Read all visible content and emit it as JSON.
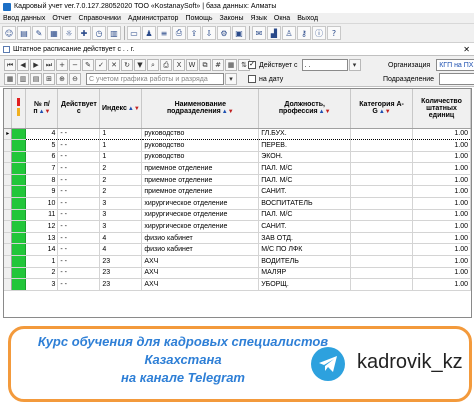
{
  "window": {
    "title": "Кадровый учет ver.7.0.127.28052020 ТОО «KostanaySoft» | база данных: Алматы"
  },
  "menu": [
    "Ввод данных",
    "Отчет",
    "Справочники",
    "Администратор",
    "Помощь",
    "Законы",
    "Язык",
    "Окна",
    "Выход"
  ],
  "document": {
    "title": "Штатное расписание действует с  .  .  г."
  },
  "filters": {
    "search_placeholder": "С учетом графика работы и разряда",
    "effective_label": "Действует с",
    "effective_value": ".  .",
    "on_date_label": "на дату",
    "organization_label": "Организация",
    "organization_value": "КГП на ПХВ",
    "department_label": "Подразделение",
    "effective_checked": "✓"
  },
  "table": {
    "columns": [
      "№ п/п",
      "Действует с",
      "Индекс",
      "Наименование подразделения",
      "Должность, профессия",
      "Категория А-G",
      "Количество штатных единиц"
    ],
    "rows": [
      {
        "n": "4",
        "from": "-  -",
        "idx": "1",
        "dept": "руководство",
        "pos": "ГЛ.БУХ.",
        "cat": "",
        "qty": "1.00"
      },
      {
        "n": "5",
        "from": "-  -",
        "idx": "1",
        "dept": "руководство",
        "pos": "ПЕРЕВ.",
        "cat": "",
        "qty": "1.00"
      },
      {
        "n": "6",
        "from": "-  -",
        "idx": "1",
        "dept": "руководство",
        "pos": "ЭКОН.",
        "cat": "",
        "qty": "1.00"
      },
      {
        "n": "7",
        "from": "-  -",
        "idx": "2",
        "dept": "приемное отделение",
        "pos": "ПАЛ. М/С",
        "cat": "",
        "qty": "1.00"
      },
      {
        "n": "8",
        "from": "-  -",
        "idx": "2",
        "dept": "приемное отделение",
        "pos": "ПАЛ. М/С",
        "cat": "",
        "qty": "1.00"
      },
      {
        "n": "9",
        "from": "-  -",
        "idx": "2",
        "dept": "приемное отделение",
        "pos": "САНИТ.",
        "cat": "",
        "qty": "1.00"
      },
      {
        "n": "10",
        "from": "-  -",
        "idx": "3",
        "dept": "хирургическое отделение",
        "pos": "ВОСПИТАТЕЛЬ",
        "cat": "",
        "qty": "1.00"
      },
      {
        "n": "11",
        "from": "-  -",
        "idx": "3",
        "dept": "хирургическое отделение",
        "pos": "ПАЛ. М/С",
        "cat": "",
        "qty": "1.00"
      },
      {
        "n": "12",
        "from": "-  -",
        "idx": "3",
        "dept": "хирургическое отделение",
        "pos": "САНИТ.",
        "cat": "",
        "qty": "1.00"
      },
      {
        "n": "13",
        "from": "-  -",
        "idx": "4",
        "dept": "физио кабинет",
        "pos": "ЗАВ ОТД.",
        "cat": "",
        "qty": "1.00"
      },
      {
        "n": "14",
        "from": "-  -",
        "idx": "4",
        "dept": "физио кабинет",
        "pos": "М/С ПО ЛФК",
        "cat": "",
        "qty": "1.00"
      },
      {
        "n": "1",
        "from": "-  -",
        "idx": "23",
        "dept": "АХЧ",
        "pos": "ВОДИТЕЛЬ",
        "cat": "",
        "qty": "1.00"
      },
      {
        "n": "2",
        "from": "-  -",
        "idx": "23",
        "dept": "АХЧ",
        "pos": "МАЛЯР",
        "cat": "",
        "qty": "1.00"
      },
      {
        "n": "3",
        "from": "-  -",
        "idx": "23",
        "dept": "АХЧ",
        "pos": "УБОРЩ.",
        "cat": "",
        "qty": "1.00"
      }
    ]
  },
  "banner": {
    "line1": "Курс обучения для кадровых специалистов",
    "line2": "Казахстана",
    "line3": "на канале Telegram",
    "handle": "kadrovik_kz"
  },
  "colors": {
    "accent_green": "#22c63a",
    "banner_border": "#f39a3c",
    "banner_text": "#2e7fd6",
    "telegram": "#2da1de"
  }
}
